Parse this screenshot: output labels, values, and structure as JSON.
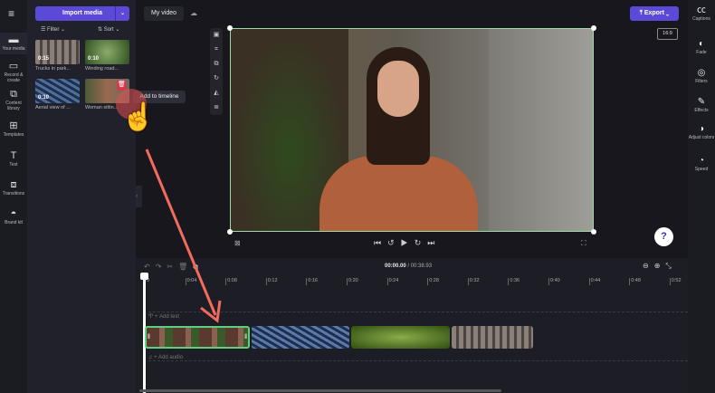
{
  "left_nav": {
    "items": [
      {
        "label": "Your media",
        "icon": "folder-icon"
      },
      {
        "label": "Record & create",
        "icon": "camera-icon"
      },
      {
        "label": "Content library",
        "icon": "library-icon"
      },
      {
        "label": "Templates",
        "icon": "templates-icon"
      },
      {
        "label": "Text",
        "icon": "text-icon"
      },
      {
        "label": "Transitions",
        "icon": "transitions-icon"
      },
      {
        "label": "Brand kit",
        "icon": "brand-icon"
      }
    ]
  },
  "media": {
    "import_label": "Import media",
    "filter_label": "Filter",
    "sort_label": "Sort",
    "items": [
      {
        "title": "Trucks in park...",
        "duration": "0:15",
        "color": "#7a6f6a"
      },
      {
        "title": "Winding road...",
        "duration": "0:10",
        "color": "#3f6a2e"
      },
      {
        "title": "Aerial view of ...",
        "duration": "0:10",
        "color": "#3a5a86"
      },
      {
        "title": "Woman sittin...",
        "duration": "",
        "color": "#6b5a48"
      }
    ],
    "tooltip": "Add to timeline"
  },
  "header": {
    "project_name": "My video",
    "export_label": "Export",
    "aspect_ratio": "16:9"
  },
  "right_nav": {
    "items": [
      {
        "label": "Captions",
        "icon": "captions-icon"
      },
      {
        "label": "Fade",
        "icon": "fade-icon"
      },
      {
        "label": "Filters",
        "icon": "filters-icon"
      },
      {
        "label": "Effects",
        "icon": "effects-icon"
      },
      {
        "label": "Adjust colors",
        "icon": "adjust-colors-icon"
      },
      {
        "label": "Speed",
        "icon": "speed-icon"
      }
    ]
  },
  "timeline": {
    "current_time": "00:00.00",
    "total_time": "/ 00:38.93",
    "ticks": [
      "0",
      "0:04",
      "0:08",
      "0:12",
      "0:16",
      "0:20",
      "0:24",
      "0:28",
      "0:32",
      "0:36",
      "0:40",
      "0:44",
      "0:48",
      "0:52"
    ],
    "add_text": "+ Add text",
    "add_audio": "+ Add audio",
    "clips": [
      {
        "color": "#6a4a3a",
        "selected": true
      },
      {
        "color": "#3a5a8a"
      },
      {
        "color": "#4f7a2a"
      },
      {
        "color": "#6e6866"
      }
    ]
  },
  "help": "?"
}
